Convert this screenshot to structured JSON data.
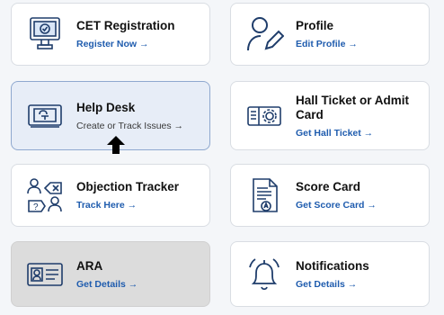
{
  "cards": [
    {
      "title": "CET Registration",
      "link": "Register Now  →",
      "icon": "monitor-check-icon"
    },
    {
      "title": "Profile",
      "link": "Edit Profile  →",
      "icon": "user-edit-icon"
    },
    {
      "title": "Help Desk",
      "link": "Create or Track Issues  →",
      "icon": "support-ticket-icon"
    },
    {
      "title": "Hall Ticket or Admit Card",
      "link": "Get Hall Ticket  →",
      "icon": "ticket-gear-icon"
    },
    {
      "title": "Objection Tracker",
      "link": "Track Here  →",
      "icon": "objection-users-icon"
    },
    {
      "title": "Score Card",
      "link": "Get Score Card  →",
      "icon": "scorecard-document-icon"
    },
    {
      "title": "ARA",
      "link": "Get Details  →",
      "icon": "id-card-icon"
    },
    {
      "title": "Notifications",
      "link": "Get Details  →",
      "icon": "bell-icon"
    }
  ],
  "colors": {
    "accent": "#1f5cae",
    "active_bg": "#e7edf7",
    "muted_bg": "#dcdcdc"
  }
}
